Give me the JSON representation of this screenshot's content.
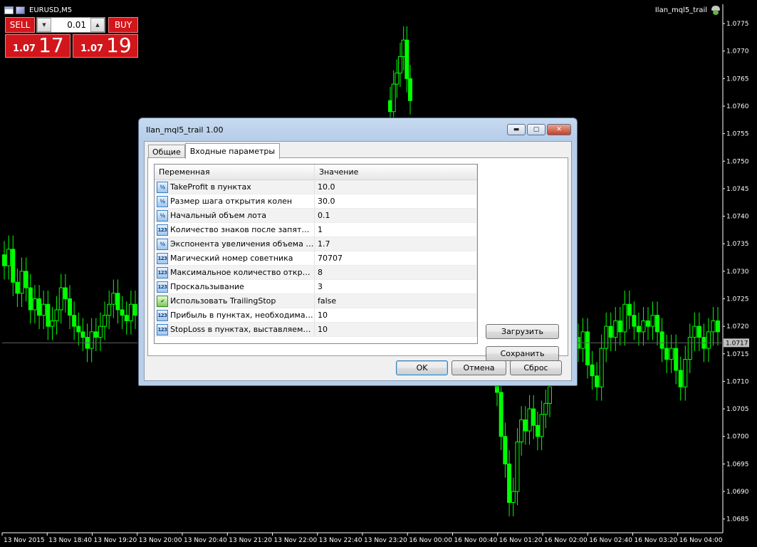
{
  "chart": {
    "symbol_title": "EURUSD,M5",
    "ea_name": "Ilan_mql5_trail",
    "current_price_label": "1.0717",
    "colors": {
      "background": "#000000",
      "candle": "#00ff00",
      "axis": "#ffffff",
      "price_marker": "#c0c0c0"
    },
    "icons": [
      "table-icon",
      "chart-picture-icon",
      "expert-hat-icon"
    ]
  },
  "chart_data": {
    "type": "candlestick",
    "y_ticks": [
      "1.0775",
      "1.0770",
      "1.0765",
      "1.0760",
      "1.0755",
      "1.0750",
      "1.0745",
      "1.0740",
      "1.0735",
      "1.0730",
      "1.0725",
      "1.0720",
      "1.0715",
      "1.0710",
      "1.0705",
      "1.0700",
      "1.0695",
      "1.0690",
      "1.0685"
    ],
    "x_ticks": [
      "13 Nov 2015",
      "13 Nov 18:40",
      "13 Nov 19:20",
      "13 Nov 20:00",
      "13 Nov 20:40",
      "13 Nov 21:20",
      "13 Nov 22:00",
      "13 Nov 22:40",
      "13 Nov 23:20",
      "16 Nov 00:00",
      "16 Nov 00:40",
      "16 Nov 01:20",
      "16 Nov 02:00",
      "16 Nov 02:40",
      "16 Nov 03:20",
      "16 Nov 04:00"
    ],
    "ylim": [
      1.06825,
      1.07785
    ],
    "current_price": 1.0717,
    "series": [
      {
        "values": [
          1.0731,
          1.0734,
          1.0728,
          1.0726,
          1.073,
          1.0727,
          1.0723,
          1.0725,
          1.0722,
          1.0724,
          1.072,
          1.0721,
          1.0723,
          1.0727,
          1.0725,
          1.0722,
          1.072,
          1.0719,
          1.0718,
          1.0716,
          1.0719,
          1.0718,
          1.072,
          1.0722,
          1.0724,
          1.0726,
          1.0723,
          1.0722,
          1.0721,
          1.0724,
          1.0722
        ]
      },
      {
        "values": [
          1.0759,
          1.0764,
          1.0766,
          1.0769,
          1.0772,
          1.0765,
          1.0761
        ]
      },
      {
        "values": [
          1.0708,
          1.07,
          1.0695,
          1.0688,
          1.069,
          1.0699,
          1.0703,
          1.0701,
          1.0705,
          1.0702,
          1.07,
          1.0704,
          1.0706,
          1.0709
        ]
      },
      {
        "values": [
          1.0716,
          1.0719,
          1.0713,
          1.0711,
          1.0709,
          1.0716,
          1.072,
          1.0718,
          1.0721,
          1.0719,
          1.0724,
          1.0722,
          1.072,
          1.0719,
          1.0721,
          1.072,
          1.0722,
          1.0719,
          1.0716,
          1.0714,
          1.0716,
          1.0712,
          1.0709,
          1.0714,
          1.0718,
          1.072,
          1.0718,
          1.0716,
          1.0719,
          1.0721,
          1.0719
        ]
      }
    ]
  },
  "trade_panel": {
    "sell_label": "SELL",
    "buy_label": "BUY",
    "lot_value": "0.01",
    "bid_small": "1.07",
    "bid_big": "17",
    "ask_small": "1.07",
    "ask_big": "19",
    "colors": {
      "button": "#d2161b"
    }
  },
  "dialog": {
    "title": "Ilan_mql5_trail 1.00",
    "controls": {
      "minimize": "▬",
      "maximize": "▢",
      "close": "✕"
    },
    "tabs": [
      {
        "label": "Общие"
      },
      {
        "label": "Входные параметры"
      }
    ],
    "grid": {
      "col_variable": "Переменная",
      "col_value": "Значение",
      "rows": [
        {
          "icon": "½",
          "name": "TakeProfit в пунктах",
          "value": "10.0"
        },
        {
          "icon": "½",
          "name": "Размер шага открытия колен",
          "value": "30.0"
        },
        {
          "icon": "½",
          "name": "Начальный объем лота",
          "value": "0.1"
        },
        {
          "icon": "123",
          "name": "Количество знаков после запятой в ...",
          "value": "1"
        },
        {
          "icon": "½",
          "name": "Экспонента увеличения объема лота",
          "value": "1.7"
        },
        {
          "icon": "123",
          "name": "Магический номер советника",
          "value": "70707"
        },
        {
          "icon": "123",
          "name": "Максимальное количество открыты...",
          "value": "8"
        },
        {
          "icon": "123",
          "name": "Проскальзывание",
          "value": "3"
        },
        {
          "icon": "✔",
          "name": "Использовать TrailingStop",
          "value": "false"
        },
        {
          "icon": "123",
          "name": "Прибыль в пунктах, необходимая д...",
          "value": "10"
        },
        {
          "icon": "123",
          "name": "StopLoss в пунктах, выставляемый п...",
          "value": "10"
        }
      ]
    },
    "buttons": {
      "load": "Загрузить",
      "save": "Сохранить",
      "ok": "OK",
      "cancel": "Отмена",
      "reset": "Сброс"
    }
  }
}
